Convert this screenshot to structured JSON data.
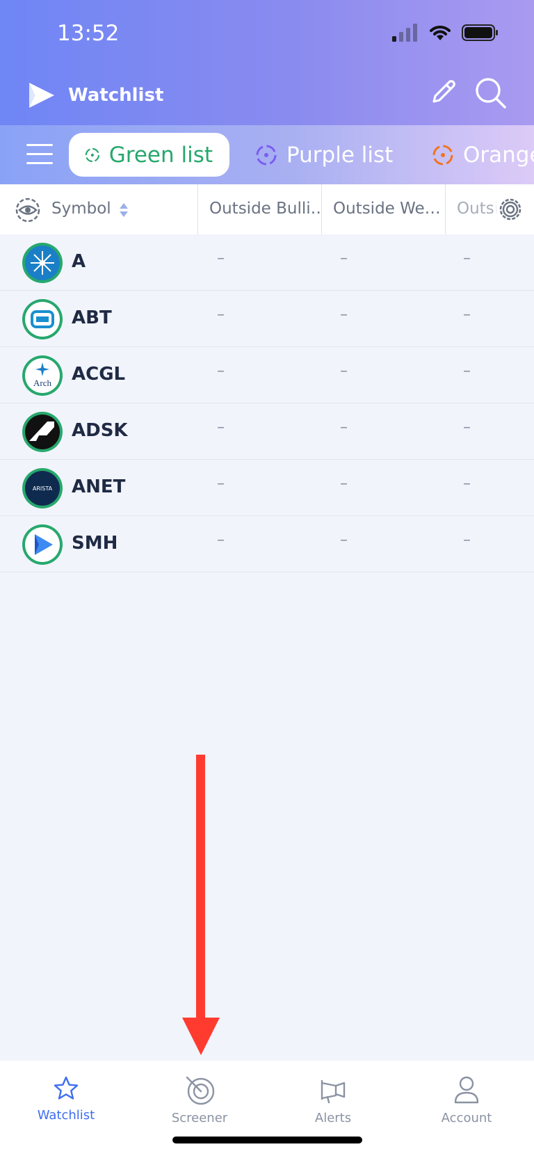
{
  "status_bar": {
    "time": "13:52",
    "icons": [
      "signal-icon",
      "wifi-icon",
      "battery-icon"
    ]
  },
  "app_bar": {
    "title": "Watchlist",
    "icons": [
      "app-logo-icon",
      "edit-pencil-icon",
      "search-icon"
    ]
  },
  "tabs": [
    {
      "label": "Green list",
      "color": "#27a86d",
      "active": true
    },
    {
      "label": "Purple list",
      "color": "#7b5cf0",
      "active": false
    },
    {
      "label": "Orange",
      "color": "#f0741c",
      "active": false
    }
  ],
  "table": {
    "symbol_header": "Symbol",
    "columns": [
      "Outside Bulli…",
      "Outside We…",
      "Outsi"
    ],
    "rows": [
      {
        "symbol": "A",
        "values": [
          "–",
          "–",
          "–"
        ]
      },
      {
        "symbol": "ABT",
        "values": [
          "–",
          "–",
          "–"
        ]
      },
      {
        "symbol": "ACGL",
        "values": [
          "–",
          "–",
          "–"
        ]
      },
      {
        "symbol": "ADSK",
        "values": [
          "–",
          "–",
          "–"
        ]
      },
      {
        "symbol": "ANET",
        "values": [
          "–",
          "–",
          "–"
        ]
      },
      {
        "symbol": "SMH",
        "values": [
          "–",
          "–",
          "–"
        ]
      }
    ]
  },
  "bottom_nav": {
    "items": [
      {
        "label": "Watchlist",
        "icon": "star-icon",
        "active": true
      },
      {
        "label": "Screener",
        "icon": "radar-icon",
        "active": false
      },
      {
        "label": "Alerts",
        "icon": "megaphone-icon",
        "active": false
      },
      {
        "label": "Account",
        "icon": "user-icon",
        "active": false
      }
    ]
  },
  "colors": {
    "accent": "#3d6df2",
    "green": "#27a86d",
    "annotation_arrow": "#ff3b30"
  }
}
